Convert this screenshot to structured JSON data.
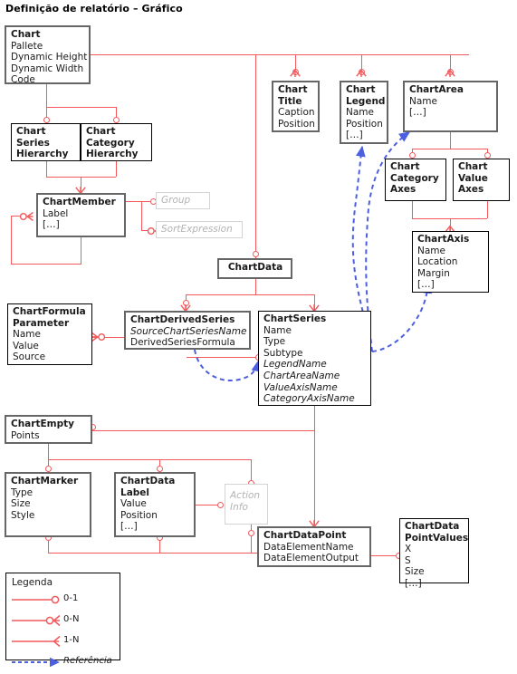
{
  "page": {
    "title": "Definição de relatório – Gráfico"
  },
  "colors": {
    "relationship": "#f2595c",
    "reference": "#4c5fe0",
    "box_border": "#666666",
    "box_border_thin": "#000000",
    "ghost_border": "#d4d4d4",
    "ghost_text": "#b3b3b3",
    "text": "#1a1a1a",
    "background": "#ffffff"
  },
  "entities": [
    {
      "id": "chart",
      "title": "Chart",
      "attributes": [
        "Pallete",
        "Dynamic Height",
        "Dynamic Width",
        "Code"
      ]
    },
    {
      "id": "chart-series-hierarchy",
      "title": "Chart Series Hierarchy",
      "title_lines": [
        "Chart",
        "Series",
        "Hierarchy"
      ],
      "attributes": []
    },
    {
      "id": "chart-category-hierarchy",
      "title": "Chart Category Hierarchy",
      "title_lines": [
        "Chart",
        "Category",
        "Hierarchy"
      ],
      "attributes": []
    },
    {
      "id": "chart-member",
      "title": "ChartMember",
      "attributes": [
        "Label",
        "[…]"
      ]
    },
    {
      "id": "chart-title",
      "title": "Chart Title",
      "title_lines": [
        "Chart",
        "Title"
      ],
      "attributes": [
        "Caption",
        "Position"
      ]
    },
    {
      "id": "chart-legend",
      "title": "Chart Legend",
      "title_lines": [
        "Chart",
        "Legend"
      ],
      "attributes": [
        "Name",
        "Position",
        "[…]"
      ]
    },
    {
      "id": "chart-area",
      "title": "ChartArea",
      "attributes": [
        "Name",
        "[…]"
      ]
    },
    {
      "id": "chart-category-axes",
      "title": "Chart Category Axes",
      "title_lines": [
        "Chart",
        "Category",
        "Axes"
      ],
      "attributes": []
    },
    {
      "id": "chart-value-axes",
      "title": "Chart Value Axes",
      "title_lines": [
        "Chart",
        "Value",
        "Axes"
      ],
      "attributes": []
    },
    {
      "id": "chart-axis",
      "title": "ChartAxis",
      "attributes": [
        "Name",
        "Location",
        "Margin",
        "[…]"
      ]
    },
    {
      "id": "chart-data",
      "title": "ChartData",
      "attributes": []
    },
    {
      "id": "chart-formula-parameter",
      "title": "ChartFormula Parameter",
      "title_lines": [
        "ChartFormula",
        "Parameter"
      ],
      "attributes": [
        "Name",
        "Value",
        "Source"
      ]
    },
    {
      "id": "chart-derived-series",
      "title": "ChartDerivedSeries",
      "attributes": [
        "SourceChartSeriesName",
        "DerivedSeriesFormula"
      ],
      "italic_attributes": [
        "SourceChartSeriesName"
      ]
    },
    {
      "id": "chart-series",
      "title": "ChartSeries",
      "attributes": [
        "Name",
        "Type",
        "Subtype",
        "LegendName",
        "ChartAreaName",
        "ValueAxisName",
        "CategoryAxisName"
      ],
      "italic_attributes": [
        "LegendName",
        "ChartAreaName",
        "ValueAxisName",
        "CategoryAxisName"
      ]
    },
    {
      "id": "chart-empty",
      "title": "ChartEmpty",
      "attributes": [
        "Points"
      ]
    },
    {
      "id": "chart-marker",
      "title": "ChartMarker",
      "attributes": [
        "Type",
        "Size",
        "Style"
      ]
    },
    {
      "id": "chart-data-label",
      "title": "ChartData Label",
      "title_lines": [
        "ChartData",
        "Label"
      ],
      "attributes": [
        "Value",
        "Position",
        "[…]"
      ]
    },
    {
      "id": "chart-data-point",
      "title": "ChartDataPoint",
      "attributes": [
        "DataElementName",
        "DataElementOutput"
      ]
    },
    {
      "id": "chart-data-point-values",
      "title": "ChartData PointValues",
      "title_lines": [
        "ChartData",
        "PointValues"
      ],
      "attributes": [
        "X",
        "S",
        "Size",
        "[…]"
      ]
    }
  ],
  "ghost_entities": [
    {
      "id": "group",
      "label": "Group"
    },
    {
      "id": "sort-expression",
      "label": "SortExpression"
    },
    {
      "id": "action-info",
      "label": "Action Info",
      "lines": [
        "Action",
        "Info"
      ]
    }
  ],
  "legend": {
    "title": "Legenda",
    "items": [
      {
        "symbol": "zero-one",
        "label": "0-1"
      },
      {
        "symbol": "zero-many",
        "label": "0-N"
      },
      {
        "symbol": "one-many",
        "label": "1-N"
      },
      {
        "symbol": "reference",
        "label": "Referência",
        "italic": true
      }
    ]
  }
}
